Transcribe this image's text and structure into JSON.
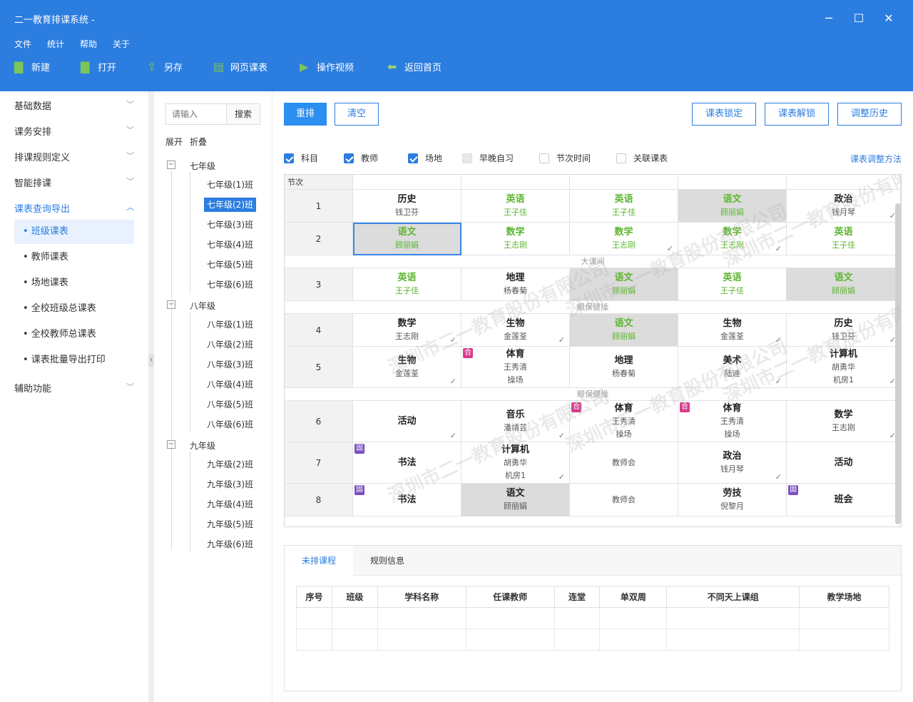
{
  "app": {
    "title": "二一教育排课系统 -",
    "colors": {
      "accent": "#2b7de0",
      "header": "#2b7de0",
      "green_text": "#5cb531"
    }
  },
  "window": {
    "minimize": "─",
    "maximize": "☐",
    "close": "✕"
  },
  "menu": [
    "文件",
    "统计",
    "帮助",
    "关于"
  ],
  "toolbar": [
    {
      "label": "新建",
      "icon": "new-file-icon"
    },
    {
      "label": "打开",
      "icon": "folder-icon"
    },
    {
      "label": "另存",
      "icon": "upload-icon"
    },
    {
      "label": "网页课表",
      "icon": "web-table-icon"
    },
    {
      "label": "操作视频",
      "icon": "video-icon"
    },
    {
      "label": "返回首页",
      "icon": "back-arrow-icon"
    }
  ],
  "nav": {
    "groups": [
      {
        "label": "基础数据"
      },
      {
        "label": "课务安排"
      },
      {
        "label": "排课规则定义"
      },
      {
        "label": "智能排课"
      },
      {
        "label": "课表查询导出"
      }
    ],
    "subs": [
      {
        "label": "班级课表"
      },
      {
        "label": "教师课表"
      },
      {
        "label": "场地课表"
      },
      {
        "label": "全校班级总课表"
      },
      {
        "label": "全校教师总课表"
      },
      {
        "label": "课表批量导出打印"
      }
    ],
    "tail": {
      "label": "辅助功能"
    }
  },
  "tree": {
    "search_placeholder": "请输入",
    "search_btn": "搜索",
    "expand": "展开",
    "collapse": "折叠",
    "grades": [
      {
        "label": "七年级",
        "classes": [
          "七年级(1)班",
          "七年级(2)班",
          "七年级(3)班",
          "七年级(4)班",
          "七年级(5)班",
          "七年级(6)班"
        ]
      },
      {
        "label": "八年级",
        "classes": [
          "八年级(1)班",
          "八年级(2)班",
          "八年级(3)班",
          "八年级(4)班",
          "八年级(5)班",
          "八年级(6)班"
        ]
      },
      {
        "label": "九年级",
        "classes": [
          "九年级(2)班",
          "九年级(3)班",
          "九年级(4)班",
          "九年级(5)班",
          "九年级(6)班"
        ]
      }
    ],
    "selected": "七年级(2)班"
  },
  "actions": {
    "rearrange": "重排",
    "clear": "清空",
    "lock": "课表锁定",
    "unlock": "课表解锁",
    "history": "调整历史"
  },
  "options": [
    {
      "label": "科目",
      "checked": true
    },
    {
      "label": "教师",
      "checked": true
    },
    {
      "label": "场地",
      "checked": true
    },
    {
      "label": "早晚自习",
      "checked": false
    },
    {
      "label": "节次时间",
      "checked": false
    },
    {
      "label": "关联课表",
      "checked": false
    }
  ],
  "adjust_link": "课表调整方法",
  "schedule": {
    "corner": "节次",
    "breaks": {
      "2": "大课间",
      "3": "眼保健操",
      "5": "眼保健操"
    },
    "watermark": "深圳市二一教育股份有限公司",
    "rows": [
      {
        "period": "1",
        "cells": [
          {
            "s": "历史",
            "t": "钱卫芬"
          },
          {
            "s": "英语",
            "t": "王子佳",
            "g": true
          },
          {
            "s": "英语",
            "t": "王子佳",
            "g": true
          },
          {
            "s": "语文",
            "t": "顾丽娟",
            "g": true,
            "bg": true
          },
          {
            "s": "政治",
            "t": "钱月琴",
            "tick": true
          }
        ]
      },
      {
        "period": "2",
        "cells": [
          {
            "s": "语文",
            "t": "顾丽娟",
            "g": true,
            "bg": true,
            "sel": true
          },
          {
            "s": "数学",
            "t": "王志刚",
            "g": true
          },
          {
            "s": "数学",
            "t": "王志刚",
            "g": true,
            "tick": true
          },
          {
            "s": "数学",
            "t": "王志刚",
            "g": true,
            "tick": true
          },
          {
            "s": "英语",
            "t": "王子佳",
            "g": true
          }
        ]
      },
      {
        "period": "3",
        "cells": [
          {
            "s": "英语",
            "t": "王子佳",
            "g": true
          },
          {
            "s": "地理",
            "t": "杨春菊"
          },
          {
            "s": "语文",
            "t": "顾丽娟",
            "g": true,
            "bg": true
          },
          {
            "s": "英语",
            "t": "王子佳",
            "g": true
          },
          {
            "s": "语文",
            "t": "顾丽娟",
            "g": true,
            "bg": true
          }
        ]
      },
      {
        "period": "4",
        "cells": [
          {
            "s": "数学",
            "t": "王志刚",
            "tick": true
          },
          {
            "s": "生物",
            "t": "金莲荃",
            "tick": true
          },
          {
            "s": "语文",
            "t": "顾丽娟",
            "g": true,
            "bg": true
          },
          {
            "s": "生物",
            "t": "金莲荃",
            "tick": true
          },
          {
            "s": "历史",
            "t": "钱卫芬",
            "tick": true
          }
        ]
      },
      {
        "period": "5",
        "cells": [
          {
            "s": "生物",
            "t": "金莲荃",
            "tick": true
          },
          {
            "s": "体育",
            "t": "王秀清",
            "r": "操场",
            "tag": "合"
          },
          {
            "s": "地理",
            "t": "杨春菊"
          },
          {
            "s": "美术",
            "t": "陆迪",
            "tick": true
          },
          {
            "s": "计算机",
            "t": "胡勇华",
            "r": "机房1",
            "tick": true
          }
        ]
      },
      {
        "period": "6",
        "cells": [
          {
            "s": "活动",
            "tick": true
          },
          {
            "s": "音乐",
            "t": "潘靖芸",
            "tick": true
          },
          {
            "s": "体育",
            "t": "王秀清",
            "r": "操场",
            "tag": "合"
          },
          {
            "s": "体育",
            "t": "王秀清",
            "r": "操场",
            "tag": "合"
          },
          {
            "s": "数学",
            "t": "王志刚",
            "tick": true
          }
        ]
      },
      {
        "period": "7",
        "cells": [
          {
            "s": "书法",
            "tag": "固"
          },
          {
            "s": "计算机",
            "t": "胡勇华",
            "r": "机房1",
            "tick": true
          },
          {
            "t": "教师会"
          },
          {
            "s": "政治",
            "t": "钱月琴",
            "tick": true
          },
          {
            "s": "活动"
          }
        ]
      },
      {
        "period": "8",
        "cells": [
          {
            "s": "书法",
            "tag": "固"
          },
          {
            "s": "语文",
            "t": "顾丽娟",
            "bg": true
          },
          {
            "t": "教师会"
          },
          {
            "s": "劳技",
            "t": "倪黎月"
          },
          {
            "s": "班会",
            "tag": "固"
          }
        ]
      }
    ]
  },
  "bottom": {
    "tabs": [
      "未排课程",
      "规则信息"
    ],
    "columns": [
      "序号",
      "班级",
      "学科名称",
      "任课教师",
      "连堂",
      "单双周",
      "不同天上课组",
      "教学场地"
    ]
  }
}
